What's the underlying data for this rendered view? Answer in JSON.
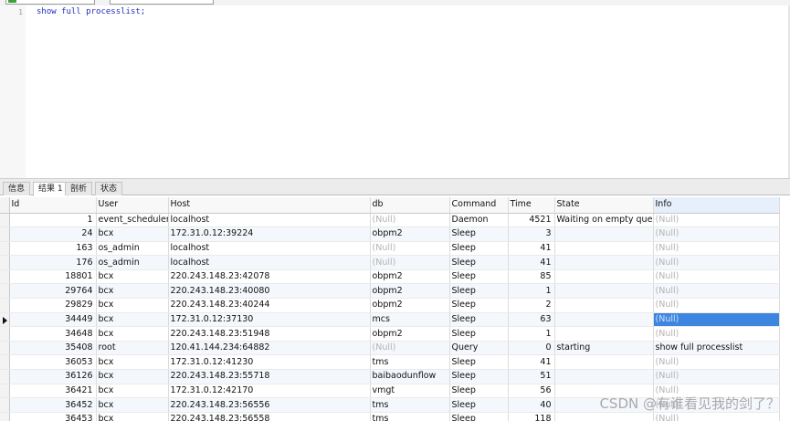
{
  "editor": {
    "line_number": "1",
    "code": "show full processlist;"
  },
  "tabs": [
    {
      "label": "信息",
      "active": false
    },
    {
      "label": "结果 1",
      "active": true
    },
    {
      "label": "剖析",
      "active": false
    },
    {
      "label": "状态",
      "active": false
    }
  ],
  "grid": {
    "columns": [
      "Id",
      "User",
      "Host",
      "db",
      "Command",
      "Time",
      "State",
      "Info"
    ],
    "null_text": "(Null)",
    "rows": [
      [
        "1",
        "event_scheduler",
        "localhost",
        "(Null)",
        "Daemon",
        "4521",
        "Waiting on empty queue",
        "(Null)"
      ],
      [
        "24",
        "bcx",
        "172.31.0.12:39224",
        "obpm2",
        "Sleep",
        "3",
        "",
        "(Null)"
      ],
      [
        "163",
        "os_admin",
        "localhost",
        "(Null)",
        "Sleep",
        "41",
        "",
        "(Null)"
      ],
      [
        "176",
        "os_admin",
        "localhost",
        "(Null)",
        "Sleep",
        "41",
        "",
        "(Null)"
      ],
      [
        "18801",
        "bcx",
        "220.243.148.23:42078",
        "obpm2",
        "Sleep",
        "85",
        "",
        "(Null)"
      ],
      [
        "29764",
        "bcx",
        "220.243.148.23:40080",
        "obpm2",
        "Sleep",
        "1",
        "",
        "(Null)"
      ],
      [
        "29829",
        "bcx",
        "220.243.148.23:40244",
        "obpm2",
        "Sleep",
        "2",
        "",
        "(Null)"
      ],
      [
        "34449",
        "bcx",
        "172.31.0.12:37130",
        "mcs",
        "Sleep",
        "63",
        "",
        "(Null)"
      ],
      [
        "34648",
        "bcx",
        "220.243.148.23:51948",
        "obpm2",
        "Sleep",
        "1",
        "",
        "(Null)"
      ],
      [
        "35408",
        "root",
        "120.41.144.234:64882",
        "(Null)",
        "Query",
        "0",
        "starting",
        "show full processlist"
      ],
      [
        "36053",
        "bcx",
        "172.31.0.12:41230",
        "tms",
        "Sleep",
        "41",
        "",
        "(Null)"
      ],
      [
        "36126",
        "bcx",
        "220.243.148.23:55718",
        "baibaodunflow",
        "Sleep",
        "51",
        "",
        "(Null)"
      ],
      [
        "36421",
        "bcx",
        "172.31.0.12:42170",
        "vmgt",
        "Sleep",
        "56",
        "",
        "(Null)"
      ],
      [
        "36452",
        "bcx",
        "220.243.148.23:56556",
        "tms",
        "Sleep",
        "40",
        "",
        "(Null)"
      ],
      [
        "36453",
        "bcx",
        "220.243.148.23:56558",
        "tms",
        "Sleep",
        "118",
        "",
        "(Null)"
      ]
    ],
    "selected_row": 7,
    "selected_col": 7
  },
  "watermark": "CSDN @有谁看见我的剑了？"
}
